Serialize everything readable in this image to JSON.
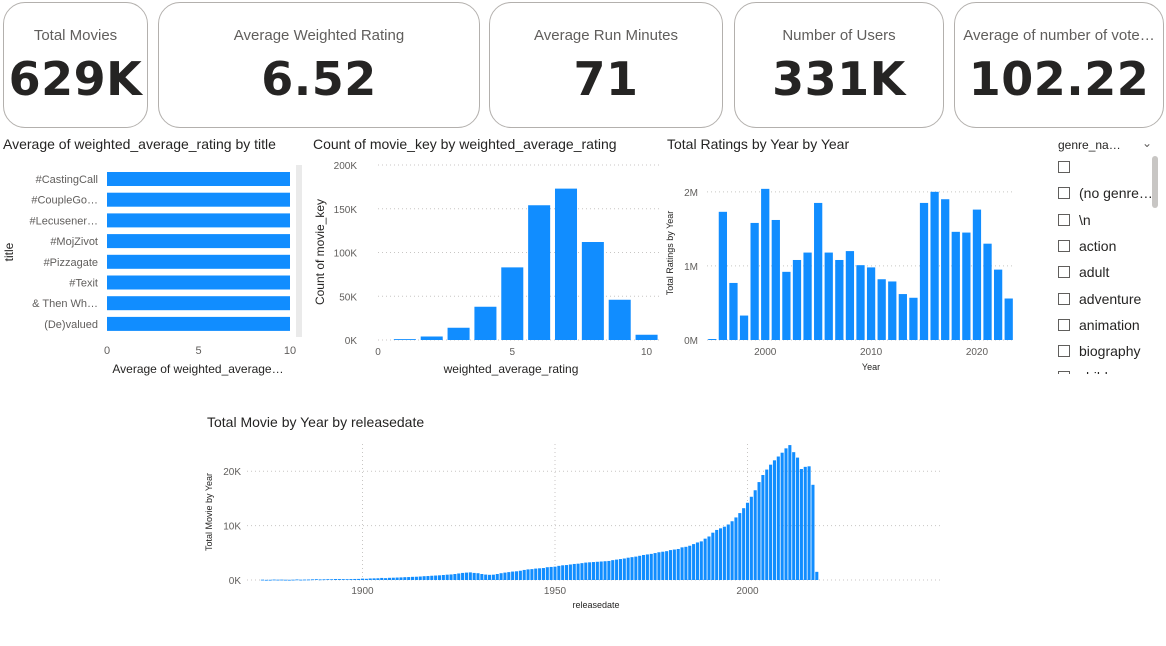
{
  "cards": [
    {
      "label": "Total Movies",
      "value": "629K"
    },
    {
      "label": "Average Weighted Rating",
      "value": "6.52"
    },
    {
      "label": "Average Run Minutes",
      "value": "71"
    },
    {
      "label": "Number of Users",
      "value": "331K"
    },
    {
      "label": "Average of number of vote…",
      "value": "102.22"
    }
  ],
  "slicer": {
    "header": "genre_na…",
    "chevron_icon": "chevron-down-icon",
    "items": [
      "",
      "(no genre…",
      "\\n",
      "action",
      "adult",
      "adventure",
      "animation",
      "biography",
      "childr"
    ]
  },
  "colors": {
    "bar": "#118dff",
    "grid": "#c8c6c4",
    "axis_text": "#605e5c"
  },
  "chart_data": [
    {
      "type": "bar",
      "orientation": "horizontal",
      "title": "Average of weighted_average_rating by title",
      "xlabel": "Average of weighted_average…",
      "ylabel": "title",
      "categories": [
        "#CastingCall",
        "#CoupleGo…",
        "#Lecusener…",
        "#MojZivot",
        "#Pizzagate",
        "#Texit",
        "& Then Wh…",
        "(De)valued"
      ],
      "values": [
        10,
        10,
        10,
        10,
        10,
        10,
        10,
        10
      ],
      "xlim": [
        0,
        10
      ],
      "xticks": [
        "0",
        "5",
        "10"
      ]
    },
    {
      "type": "bar",
      "title": "Count of movie_key by weighted_average_rating",
      "xlabel": "weighted_average_rating",
      "ylabel": "Count of movie_key",
      "x": [
        1,
        2,
        3,
        4,
        5,
        6,
        7,
        8,
        9,
        10
      ],
      "values": [
        1000,
        4000,
        14000,
        38000,
        83000,
        154000,
        173000,
        112000,
        46000,
        6000
      ],
      "ylim": [
        0,
        200000
      ],
      "yticks": [
        "0K",
        "50K",
        "100K",
        "150K",
        "200K"
      ],
      "xticks": [
        "0",
        "5",
        "10"
      ],
      "xlim": [
        0,
        10.5
      ]
    },
    {
      "type": "bar",
      "title": "Total Ratings by Year by Year",
      "xlabel": "Year",
      "ylabel": "Total Ratings by Year",
      "x": [
        1995,
        1996,
        1997,
        1998,
        1999,
        2000,
        2001,
        2002,
        2003,
        2004,
        2005,
        2006,
        2007,
        2008,
        2009,
        2010,
        2011,
        2012,
        2013,
        2014,
        2015,
        2016,
        2017,
        2018,
        2019,
        2020,
        2021,
        2022,
        2023
      ],
      "values": [
        0,
        1730000,
        770000,
        330000,
        1580000,
        2040000,
        1620000,
        920000,
        1080000,
        1180000,
        1850000,
        1180000,
        1080000,
        1200000,
        1010000,
        980000,
        820000,
        790000,
        620000,
        570000,
        1850000,
        2000000,
        1900000,
        1460000,
        1450000,
        1760000,
        1300000,
        950000,
        560000
      ],
      "ylim": [
        0,
        2200000
      ],
      "yticks": [
        "0M",
        "1M",
        "2M"
      ],
      "xticks": [
        "2000",
        "2010",
        "2020"
      ]
    },
    {
      "type": "bar",
      "title": "Total Movie by Year by releasedate",
      "xlabel": "releasedate",
      "ylabel": "Total Movie by Year",
      "x_start": 1874,
      "x_end": 2025,
      "values": [
        60,
        30,
        40,
        80,
        60,
        70,
        50,
        40,
        60,
        100,
        60,
        80,
        90,
        120,
        150,
        110,
        130,
        150,
        140,
        180,
        170,
        160,
        150,
        170,
        190,
        200,
        250,
        220,
        280,
        300,
        320,
        380,
        340,
        400,
        420,
        450,
        480,
        520,
        540,
        580,
        600,
        640,
        700,
        730,
        780,
        820,
        860,
        920,
        980,
        1020,
        1100,
        1200,
        1300,
        1360,
        1400,
        1300,
        1250,
        1100,
        1000,
        950,
        980,
        1100,
        1250,
        1360,
        1450,
        1550,
        1600,
        1700,
        1850,
        1950,
        2000,
        2100,
        2150,
        2200,
        2350,
        2400,
        2450,
        2600,
        2700,
        2750,
        2850,
        2950,
        3000,
        3100,
        3200,
        3250,
        3300,
        3350,
        3400,
        3450,
        3500,
        3650,
        3750,
        3850,
        3950,
        4100,
        4200,
        4300,
        4450,
        4600,
        4700,
        4800,
        4950,
        5100,
        5200,
        5300,
        5500,
        5600,
        5700,
        6000,
        6100,
        6300,
        6600,
        6900,
        7100,
        7600,
        8000,
        8700,
        9200,
        9500,
        9800,
        10200,
        10800,
        11500,
        12300,
        13200,
        14200,
        15300,
        16500,
        18000,
        19300,
        20300,
        21200,
        22000,
        22700,
        23400,
        24200,
        24800,
        23500,
        22500,
        20400,
        20800,
        20900,
        17500,
        1500
      ],
      "ylim": [
        0,
        25000
      ],
      "yticks": [
        "0K",
        "10K",
        "20K"
      ],
      "xticks": [
        "1900",
        "1950",
        "2000"
      ]
    }
  ]
}
